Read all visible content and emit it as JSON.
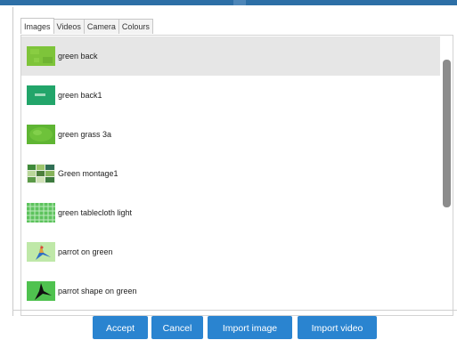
{
  "tabs": [
    {
      "label": "Images",
      "active": true
    },
    {
      "label": "Videos",
      "active": false
    },
    {
      "label": "Camera",
      "active": false
    },
    {
      "label": "Colours",
      "active": false
    }
  ],
  "items": [
    {
      "label": "green back",
      "icon": "green-texture-thumb",
      "selected": true
    },
    {
      "label": "green back1",
      "icon": "green-banner-thumb",
      "selected": false
    },
    {
      "label": "green grass 3a",
      "icon": "grass-thumb",
      "selected": false
    },
    {
      "label": "Green montage1",
      "icon": "montage-thumb",
      "selected": false
    },
    {
      "label": "green tablecloth light",
      "icon": "tablecloth-thumb",
      "selected": false
    },
    {
      "label": "parrot on green",
      "icon": "parrot-thumb",
      "selected": false
    },
    {
      "label": "parrot shape on green",
      "icon": "parrot-shape-thumb",
      "selected": false
    }
  ],
  "buttons": {
    "accept": "Accept",
    "cancel": "Cancel",
    "import_image": "Import image",
    "import_video": "Import video"
  },
  "colors": {
    "accent": "#2a84d0",
    "header_bar": "#2d6fa6",
    "selected_row": "#e6e6e6",
    "scrollbar_thumb": "#8c8c8c"
  }
}
